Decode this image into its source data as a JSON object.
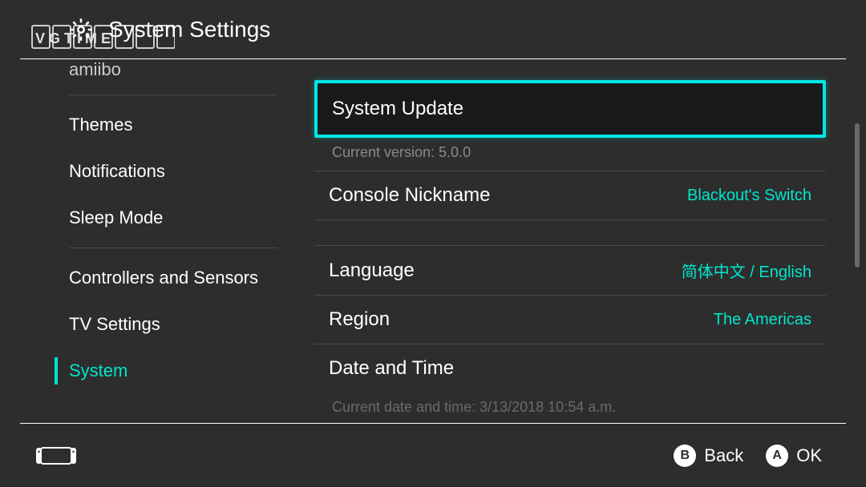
{
  "header": {
    "title": "System Settings"
  },
  "sidebar": {
    "items": [
      {
        "label": "amiibo",
        "partial": true
      },
      {
        "label": "Themes"
      },
      {
        "label": "Notifications"
      },
      {
        "label": "Sleep Mode"
      },
      {
        "label": "Controllers and Sensors"
      },
      {
        "label": "TV Settings"
      },
      {
        "label": "System",
        "selected": true
      }
    ]
  },
  "content": {
    "system_update": {
      "label": "System Update",
      "sub": "Current version: 5.0.0"
    },
    "console_nickname": {
      "label": "Console Nickname",
      "value": "Blackout's Switch"
    },
    "language": {
      "label": "Language",
      "value": "简体中文 / English"
    },
    "region": {
      "label": "Region",
      "value": "The Americas"
    },
    "date_time": {
      "label": "Date and Time",
      "sub": "Current date and time: 3/13/2018 10:54 a.m."
    }
  },
  "footer": {
    "back": {
      "button": "B",
      "label": "Back"
    },
    "ok": {
      "button": "A",
      "label": "OK"
    }
  },
  "watermark": "VGTIME"
}
